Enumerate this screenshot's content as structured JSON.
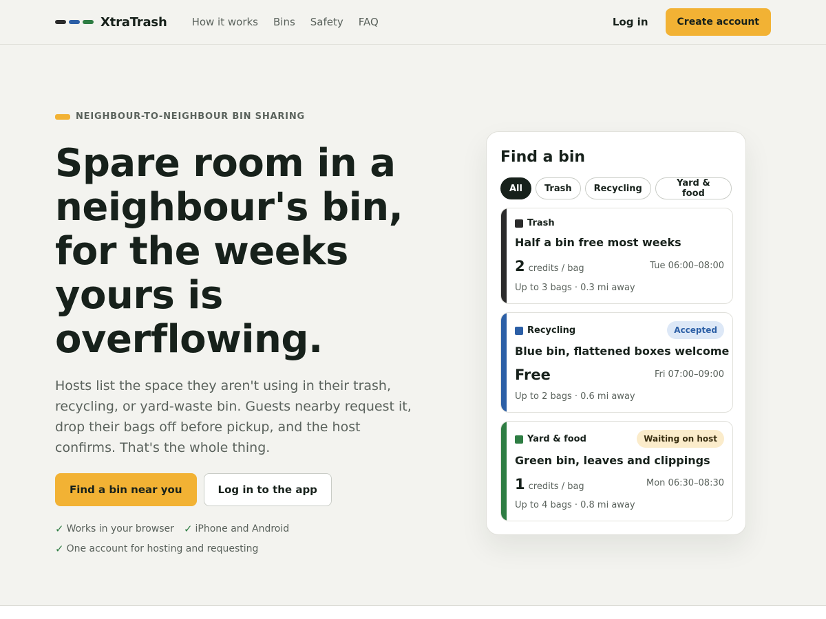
{
  "brand": {
    "name": "XtraTrash",
    "logo_colors": [
      "#2b2b2b",
      "#2c5fa6",
      "#2e7d43"
    ]
  },
  "nav": {
    "links": [
      "How it works",
      "Bins",
      "Safety",
      "FAQ"
    ],
    "login": "Log in",
    "create_account": "Create account"
  },
  "hero": {
    "eyebrow": "NEIGHBOUR-TO-NEIGHBOUR BIN SHARING",
    "eyebrow_color": "#f2b234",
    "headline": "Spare room in a neighbour's bin, for the weeks yours is overflowing.",
    "lede": "Hosts list the space they aren't using in their trash, recycling, or yard-waste bin. Guests nearby request it, drop their bags off before pickup, and the host confirms. That's the whole thing.",
    "primary_cta": "Find a bin near you",
    "secondary_cta": "Log in to the app",
    "checks": [
      "Works in your browser",
      "iPhone and Android",
      "One account for hosting and requesting"
    ],
    "check_icon": "check-icon"
  },
  "finder": {
    "title": "Find a bin",
    "filters": [
      {
        "label": "All",
        "active": true
      },
      {
        "label": "Trash",
        "active": false
      },
      {
        "label": "Recycling",
        "active": false
      },
      {
        "label": "Yard & food",
        "active": false
      }
    ],
    "listings": [
      {
        "category": "Trash",
        "color": "#2b2b2b",
        "badge": "",
        "title": "Half a bin free most weeks",
        "price": "2",
        "price_unit": "credits / bag",
        "time": "Tue 06:00–08:00",
        "meta": "Up to 3 bags · 0.3 mi away"
      },
      {
        "category": "Recycling",
        "color": "#2c5fa6",
        "badge": "Accepted",
        "badge_bg": "#dde8f7",
        "badge_fg": "#2c5fa6",
        "title": "Blue bin, flattened boxes welcome",
        "price": "Free",
        "price_unit": "",
        "time": "Fri 07:00–09:00",
        "meta": "Up to 2 bags · 0.6 mi away"
      },
      {
        "category": "Yard & food",
        "color": "#2e7d43",
        "badge": "Waiting on host",
        "badge_bg": "#fbeccb",
        "badge_fg": "#3a2f12",
        "title": "Green bin, leaves and clippings",
        "price": "1",
        "price_unit": "credits / bag",
        "time": "Mon 06:30–08:30",
        "meta": "Up to 4 bags · 0.8 mi away"
      }
    ]
  }
}
